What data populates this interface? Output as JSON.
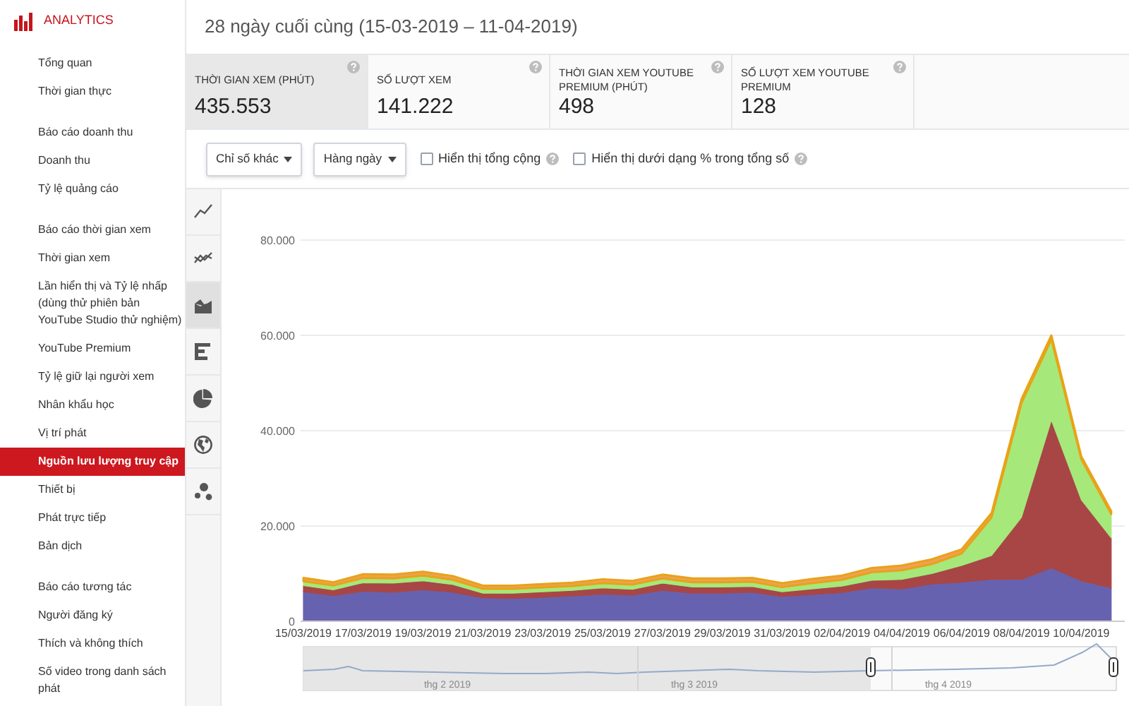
{
  "sidebar": {
    "title": "ANALYTICS",
    "groups": [
      [
        {
          "label": "Tổng quan",
          "selected": false
        },
        {
          "label": "Thời gian thực",
          "selected": false
        }
      ],
      [
        {
          "label": "Báo cáo doanh thu",
          "selected": false
        },
        {
          "label": "Doanh thu",
          "selected": false
        },
        {
          "label": "Tỷ lệ quảng cáo",
          "selected": false
        }
      ],
      [
        {
          "label": "Báo cáo thời gian xem",
          "selected": false
        },
        {
          "label": "Thời gian xem",
          "selected": false
        },
        {
          "label": "Lần hiển thị và Tỷ lệ nhấp (dùng thử phiên bản YouTube Studio thử nghiệm)",
          "selected": false
        },
        {
          "label": "YouTube Premium",
          "selected": false
        },
        {
          "label": "Tỷ lệ giữ lại người xem",
          "selected": false
        },
        {
          "label": "Nhân khẩu học",
          "selected": false
        },
        {
          "label": "Vị trí phát",
          "selected": false
        },
        {
          "label": "Nguồn lưu lượng truy cập",
          "selected": true
        },
        {
          "label": "Thiết bị",
          "selected": false
        },
        {
          "label": "Phát trực tiếp",
          "selected": false
        },
        {
          "label": "Bản dịch",
          "selected": false
        }
      ],
      [
        {
          "label": "Báo cáo tương tác",
          "selected": false
        },
        {
          "label": "Người đăng ký",
          "selected": false
        },
        {
          "label": "Thích và không thích",
          "selected": false
        },
        {
          "label": "Số video trong danh sách phát",
          "selected": false
        }
      ]
    ]
  },
  "header": {
    "date_range": "28 ngày cuối cùng (15-03-2019 – 11-04-2019)"
  },
  "metrics": [
    {
      "label": "THỜI GIAN XEM (PHÚT)",
      "value": "435.553",
      "selected": true
    },
    {
      "label": "SỐ LƯỢT XEM",
      "value": "141.222",
      "selected": false
    },
    {
      "label": "THỜI GIAN XEM YOUTUBE PREMIUM (PHÚT)",
      "value": "498",
      "selected": false
    },
    {
      "label": "SỐ LƯỢT XEM YOUTUBE PREMIUM",
      "value": "128",
      "selected": false
    }
  ],
  "controls": {
    "dropdowns": [
      "Chỉ số khác",
      "Hàng ngày"
    ],
    "checkboxes": [
      {
        "label": "Hiển thị tổng cộng",
        "checked": false
      },
      {
        "label": "Hiển thị dưới dạng % trong tổng số",
        "checked": false
      }
    ]
  },
  "chart_types": [
    {
      "kind": "line",
      "selected": false
    },
    {
      "kind": "multiline",
      "selected": false
    },
    {
      "kind": "area",
      "selected": true
    },
    {
      "kind": "bar",
      "selected": false
    },
    {
      "kind": "pie",
      "selected": false
    },
    {
      "kind": "globe",
      "selected": false
    },
    {
      "kind": "bubble",
      "selected": false
    }
  ],
  "chart": {
    "chart_data": {
      "type": "area",
      "stacked": true,
      "grid": true,
      "categories": [
        "15/03/2019",
        null,
        "17/03/2019",
        null,
        "19/03/2019",
        null,
        "21/03/2019",
        null,
        "23/03/2019",
        null,
        "25/03/2019",
        null,
        "27/03/2019",
        null,
        "29/03/2019",
        null,
        "31/03/2019",
        null,
        "02/04/2019",
        null,
        "04/04/2019",
        null,
        "06/04/2019",
        null,
        "08/04/2019",
        null,
        "10/04/2019",
        null
      ],
      "ylim": [
        0,
        80000
      ],
      "yticks": [
        {
          "value": 0,
          "label": "0"
        },
        {
          "value": 20000,
          "label": "20.000"
        },
        {
          "value": 40000,
          "label": "40.000"
        },
        {
          "value": 60000,
          "label": "60.000"
        },
        {
          "value": 80000,
          "label": "80.000"
        }
      ],
      "series": [
        {
          "color": "#6762b0",
          "values": [
            6200,
            5400,
            6300,
            6100,
            6600,
            6100,
            4900,
            4800,
            5000,
            5300,
            5700,
            5500,
            6500,
            5900,
            5900,
            6100,
            5200,
            5600,
            6000,
            7000,
            6800,
            7800,
            8200,
            8800,
            8800,
            11200,
            8500,
            7000
          ]
        },
        {
          "color": "#a84646",
          "values": [
            1300,
            1200,
            1800,
            1900,
            1900,
            1600,
            1000,
            1100,
            1200,
            1200,
            1300,
            1200,
            1500,
            1300,
            1300,
            1200,
            1000,
            1200,
            1400,
            1600,
            2000,
            2200,
            3500,
            5000,
            13000,
            31000,
            17000,
            10500
          ]
        },
        {
          "color": "#a6e87a",
          "values": [
            900,
            900,
            1000,
            1000,
            1100,
            1000,
            900,
            900,
            900,
            900,
            1000,
            1000,
            1000,
            1000,
            1000,
            1000,
            1000,
            1200,
            1300,
            1700,
            1900,
            2000,
            2500,
            8000,
            24000,
            17000,
            8500,
            5000
          ]
        },
        {
          "color": "#f0a05a",
          "values": [
            700,
            700,
            800,
            800,
            800,
            800,
            700,
            700,
            700,
            700,
            800,
            800,
            800,
            800,
            800,
            800,
            800,
            900,
            900,
            900,
            1000,
            1000,
            900,
            900,
            800,
            800,
            600,
            600
          ]
        }
      ]
    }
  },
  "navigator": {
    "labels": [
      "thg 2 2019",
      "thg 3 2019",
      "thg 4 2019"
    ]
  }
}
